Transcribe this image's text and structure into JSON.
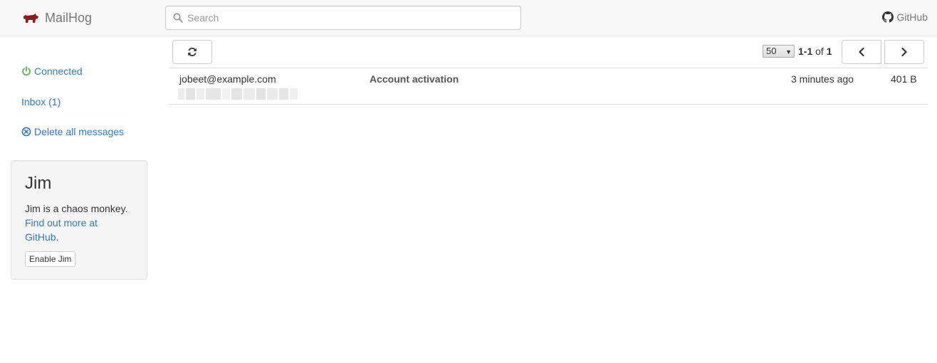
{
  "navbar": {
    "brand": "MailHog",
    "search_placeholder": "Search",
    "github_label": "GitHub",
    "brand_color": "#8b1a1a"
  },
  "sidebar": {
    "connected_label": "Connected",
    "inbox_label": "Inbox (1)",
    "delete_all_label": "Delete all messages",
    "connected_color": "#5cb85c",
    "link_color": "#337ab7"
  },
  "jim": {
    "title": "Jim",
    "description": "Jim is a chaos monkey.",
    "link_text": "Find out more at GitHub",
    "link_suffix": ".",
    "enable_button": "Enable Jim"
  },
  "toolbar": {
    "refresh_icon": "refresh-icon",
    "page_size": "50",
    "range": "1-1",
    "of_label": "of",
    "total": "1",
    "prev_icon": "chevron-left-icon",
    "next_icon": "chevron-right-icon"
  },
  "messages": [
    {
      "from": "jobeet@example.com",
      "subject": "Account activation",
      "time": "3 minutes ago",
      "size": "401 B"
    }
  ]
}
